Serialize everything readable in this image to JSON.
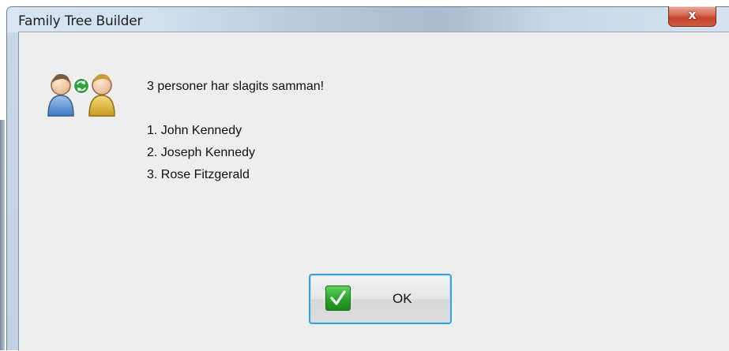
{
  "window": {
    "title": "Family Tree Builder",
    "close_glyph": "x"
  },
  "dialog": {
    "icon": "merge-persons-icon",
    "message": "3 personer har slagits samman!",
    "persons": [
      "1. John Kennedy",
      "2. Joseph Kennedy",
      "3. Rose Fitzgerald"
    ],
    "ok_button": {
      "label": "OK",
      "icon": "green-check-icon"
    }
  },
  "colors": {
    "accent_border": "#3c9fe0",
    "close_button": "#c4432a",
    "check_green": "#2aa32a",
    "client_background": "#eeeeee"
  }
}
